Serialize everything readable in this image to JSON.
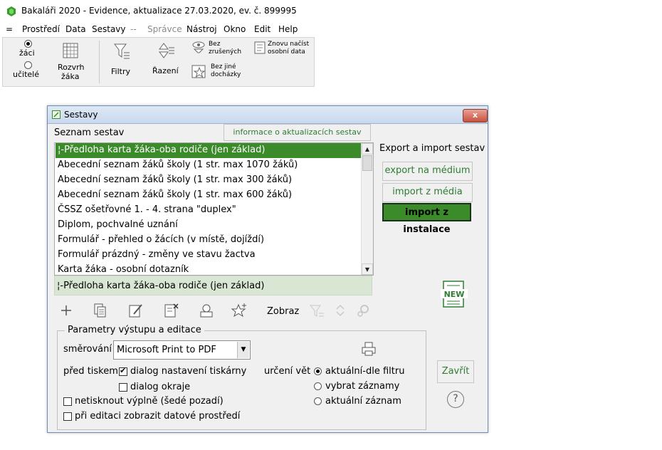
{
  "window": {
    "title": "Bakaláři 2020 - Evidence, aktualizace 27.03.2020, ev. č. 899995"
  },
  "menu": {
    "items": [
      "=",
      "Prostředí",
      "Data",
      "Sestavy",
      "--",
      "Správce",
      "Nástroj",
      "Okno",
      "Edit",
      "Help"
    ]
  },
  "toolbar": {
    "radio_zaci": "žáci",
    "radio_ucitele": "učitelé",
    "selected_radio": "žáci",
    "rozvrh_line1": "Rozvrh",
    "rozvrh_line2": "žáka",
    "filtry": "Filtry",
    "razeni": "Řazení",
    "bez_zrusenych_1": "Bez",
    "bez_zrusenych_2": "zrušených",
    "znovu_1": "Znovu načíst",
    "znovu_2": "osobní data",
    "bez_dochazky_1": "Bez jiné",
    "bez_dochazky_2": "docházky"
  },
  "dialog": {
    "title": "Sestavy",
    "close_label": "x",
    "list_heading": "Seznam sestav",
    "info_button": "informace o aktualizacích sestav",
    "list_items": [
      "¦-Předloha karta žáka-oba rodiče (jen základ)",
      "Abecední seznam žáků školy (1 str. max 1070 žáků)",
      "Abecední seznam žáků školy (1 str. max 300 žáků)",
      "Abecední seznam žáků školy (1 str. max 600 žáků)",
      "ČSSZ ošetřovné 1. - 4. strana \"duplex\"",
      "Diplom, pochvalné uznání",
      "Formulář - přehled o žácích (v místě, dojíždí)",
      "Formulář prázdný - změny ve stavu žactva",
      "Karta žáka - osobní dotazník"
    ],
    "selected_item": "¦-Předloha karta žáka-oba rodiče (jen základ)",
    "export_heading": "Export a import sestav",
    "btn_export": "export na médium",
    "btn_import_media": "import z média",
    "btn_import_install": "import z instalace",
    "new_badge": "NEW",
    "zobraz": "Zobraz",
    "params": {
      "legend": "Parametry výstupu a editace",
      "smerovani_label": "směrování",
      "printer_value": "Microsoft Print to PDF",
      "pred_tiskem_label": "před tiskem",
      "chk_dialog_tiskarny": "dialog nastavení tiskárny",
      "chk_dialog_okraje": "dialog okraje",
      "chk_netisknout": "netisknout výplně (šedé pozadí)",
      "chk_editace": "při editaci zobrazit datové prostředí",
      "chk_dialog_tiskarny_checked": true,
      "urceni_vet_label": "určení vět",
      "radio_aktualni_filtr": "aktuální-dle filtru",
      "radio_vybrat": "vybrat záznamy",
      "radio_aktualni": "aktuální záznam",
      "selected_urceni": "aktuální-dle filtru"
    },
    "btn_zavrit": "Zavřít",
    "help_symbol": "?"
  },
  "colors": {
    "accent_green": "#3b8b2b",
    "button_text_green": "#2e7d32",
    "dialog_border": "#6d8db5",
    "close_red": "#c7513e"
  }
}
